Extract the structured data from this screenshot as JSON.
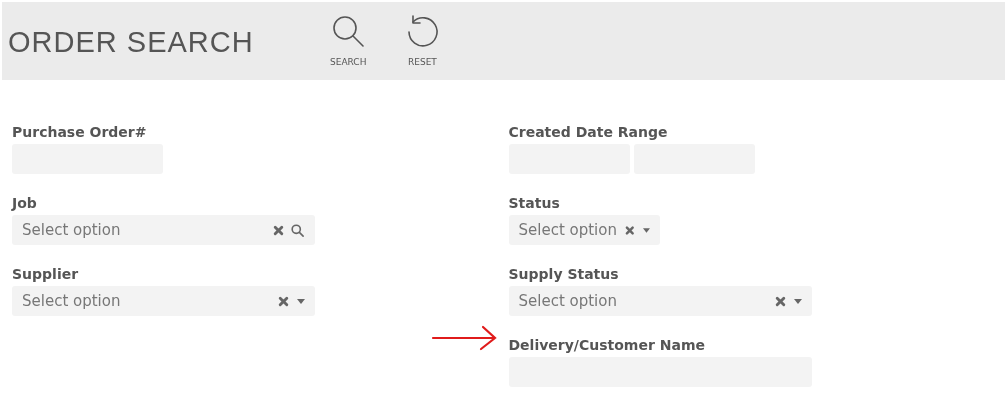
{
  "header": {
    "title": "ORDER SEARCH",
    "actions": [
      {
        "kind": "search",
        "label": "SEARCH"
      },
      {
        "kind": "reset",
        "label": "RESET"
      }
    ]
  },
  "columns": [
    {
      "fields": [
        {
          "kind": "text",
          "label": "Purchase Order#",
          "pointed": false
        },
        {
          "kind": "select",
          "label": "Job",
          "placeholder": "Select option",
          "clearable": true,
          "searchable": true,
          "pointed": false
        },
        {
          "kind": "select",
          "label": "Supplier",
          "placeholder": "Select option",
          "clearable": true,
          "searchable": false,
          "pointed": false
        }
      ]
    },
    {
      "fields": [
        {
          "kind": "daterange",
          "label": "Created Date Range",
          "pointed": false
        },
        {
          "kind": "select",
          "label": "Status",
          "placeholder": "Select option",
          "clearable": true,
          "searchable": false,
          "pointed": false
        },
        {
          "kind": "select",
          "label": "Supply Status",
          "placeholder": "Select option",
          "clearable": true,
          "searchable": false,
          "pointed": false
        },
        {
          "kind": "text",
          "label": "Delivery/Customer Name",
          "pointed": true
        }
      ]
    }
  ]
}
